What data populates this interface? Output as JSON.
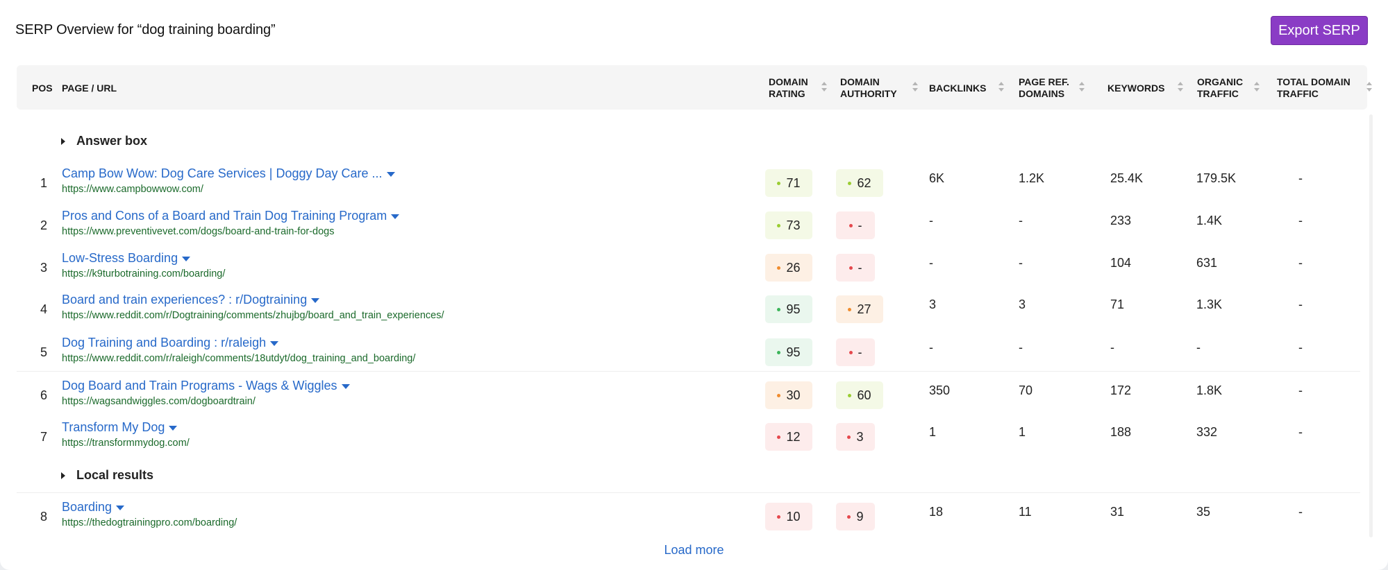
{
  "header": {
    "title": "SERP Overview for “dog training boarding”",
    "export_label": "Export SERP"
  },
  "columns": {
    "pos": "POS",
    "page": "PAGE / URL",
    "dr": [
      "DOMAIN",
      "RATING"
    ],
    "da": [
      "DOMAIN",
      "AUTHORITY"
    ],
    "backlinks": "BACKLINKS",
    "prd": [
      "PAGE REF.",
      "DOMAINS"
    ],
    "keywords": "KEYWORDS",
    "traffic": [
      "ORGANIC",
      "TRAFFIC"
    ],
    "tdt": [
      "TOTAL DOMAIN",
      "TRAFFIC"
    ]
  },
  "groups": {
    "answer_box": "Answer box",
    "local_results": "Local results"
  },
  "rows": [
    {
      "pos": "1",
      "title": "Camp Bow Wow: Dog Care Services | Doggy Day Care ...",
      "url": "https://www.campbowwow.com/",
      "dr": "71",
      "da": "62",
      "backlinks": "6K",
      "prd": "1.2K",
      "keywords": "25.4K",
      "traffic": "179.5K",
      "tdt": "-"
    },
    {
      "pos": "2",
      "title": "Pros and Cons of a Board and Train Dog Training Program",
      "url": "https://www.preventivevet.com/dogs/board-and-train-for-dogs",
      "dr": "73",
      "da": "-",
      "backlinks": "-",
      "prd": "-",
      "keywords": "233",
      "traffic": "1.4K",
      "tdt": "-"
    },
    {
      "pos": "3",
      "title": "Low-Stress Boarding",
      "url": "https://k9turbotraining.com/boarding/",
      "dr": "26",
      "da": "-",
      "backlinks": "-",
      "prd": "-",
      "keywords": "104",
      "traffic": "631",
      "tdt": "-"
    },
    {
      "pos": "4",
      "title": "Board and train experiences? : r/Dogtraining",
      "url": "https://www.reddit.com/r/Dogtraining/comments/zhujbg/board_and_train_experiences/",
      "dr": "95",
      "da": "27",
      "backlinks": "3",
      "prd": "3",
      "keywords": "71",
      "traffic": "1.3K",
      "tdt": "-"
    },
    {
      "pos": "5",
      "title": "Dog Training and Boarding : r/raleigh",
      "url": "https://www.reddit.com/r/raleigh/comments/18utdyt/dog_training_and_boarding/",
      "dr": "95",
      "da": "-",
      "backlinks": "-",
      "prd": "-",
      "keywords": "-",
      "traffic": "-",
      "tdt": "-"
    },
    {
      "pos": "6",
      "title": "Dog Board and Train Programs - Wags & Wiggles",
      "url": "https://wagsandwiggles.com/dogboardtrain/",
      "dr": "30",
      "da": "60",
      "backlinks": "350",
      "prd": "70",
      "keywords": "172",
      "traffic": "1.8K",
      "tdt": "-"
    },
    {
      "pos": "7",
      "title": "Transform My Dog",
      "url": "https://transformmydog.com/",
      "dr": "12",
      "da": "3",
      "backlinks": "1",
      "prd": "1",
      "keywords": "188",
      "traffic": "332",
      "tdt": "-"
    },
    {
      "pos": "8",
      "title": "Boarding",
      "url": "https://thedogtrainingpro.com/boarding/",
      "dr": "10",
      "da": "9",
      "backlinks": "18",
      "prd": "11",
      "keywords": "31",
      "traffic": "35",
      "tdt": "-"
    }
  ],
  "load_more": "Load more",
  "colors": {
    "accent": "#8a3cc5",
    "link": "#2769c9",
    "url": "#1b6a2b",
    "score_green": "#3cb55a",
    "score_lime": "#9acd32",
    "score_orange": "#f08c2e",
    "score_red": "#e5484d"
  }
}
